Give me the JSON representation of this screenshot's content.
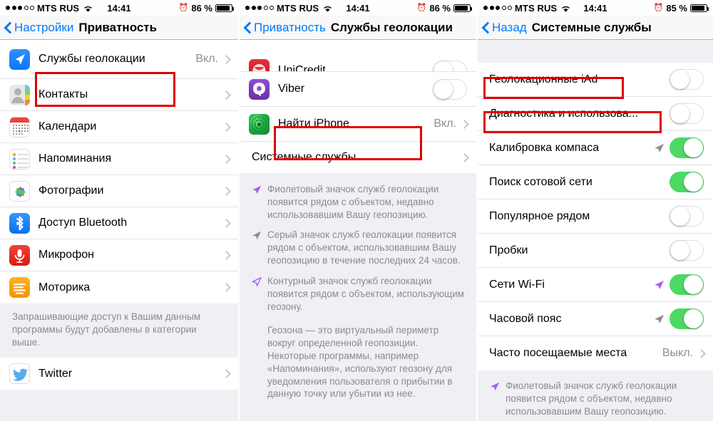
{
  "screens": [
    {
      "id": "privacy",
      "status": {
        "carrier": "MTS RUS",
        "time": "14:41",
        "battery": "86 %",
        "signal_dots": 5,
        "signal_filled": 3
      },
      "nav": {
        "back_label": "Настройки",
        "title": "Приватность"
      },
      "groups": [
        {
          "rows": [
            {
              "label": "Службы геолокации",
              "value": "Вкл.",
              "icon": "location-arrow-icon",
              "accessory": "chevron",
              "highlight": true
            },
            {
              "label": "Контакты",
              "value": "",
              "icon": "contacts-icon",
              "accessory": "chevron"
            },
            {
              "label": "Календари",
              "value": "",
              "icon": "calendar-icon",
              "accessory": "chevron"
            },
            {
              "label": "Напоминания",
              "value": "",
              "icon": "reminders-icon",
              "accessory": "chevron"
            },
            {
              "label": "Фотографии",
              "value": "",
              "icon": "photos-icon",
              "accessory": "chevron"
            },
            {
              "label": "Доступ Bluetooth",
              "value": "",
              "icon": "bluetooth-icon",
              "accessory": "chevron"
            },
            {
              "label": "Микрофон",
              "value": "",
              "icon": "microphone-icon",
              "accessory": "chevron"
            },
            {
              "label": "Моторика",
              "value": "",
              "icon": "motion-icon",
              "accessory": "chevron"
            }
          ]
        }
      ],
      "footer": "Запрашивающие доступ к Вашим данным программы будут добавлены в категории выше.",
      "group2": {
        "rows": [
          {
            "label": "Twitter",
            "value": "",
            "icon": "twitter-icon",
            "accessory": "chevron"
          }
        ]
      }
    },
    {
      "id": "location-services",
      "status": {
        "carrier": "MTS RUS",
        "time": "14:41",
        "battery": "86 %",
        "signal_dots": 5,
        "signal_filled": 3
      },
      "nav": {
        "back_label": "Приватность",
        "title": "Службы геолокации"
      },
      "groups": [
        {
          "rows": [
            {
              "label": "UniCredit",
              "icon": "unicredit-icon",
              "accessory": "toggle",
              "toggle": "off",
              "clipped": true
            },
            {
              "label": "Viber",
              "icon": "viber-icon",
              "accessory": "toggle",
              "toggle": "off"
            },
            {
              "label": "Найти iPhone",
              "value": "Вкл.",
              "icon": "find-iphone-icon",
              "accessory": "chevron"
            },
            {
              "label": "Системные службы",
              "value": "",
              "icon": "",
              "accessory": "chevron",
              "highlight": true
            }
          ]
        }
      ],
      "notes": [
        {
          "glyph": "purple",
          "text": "Фиолетовый значок служб геолокации появится рядом с объектом, недавно использовавшим Вашу геопозицию."
        },
        {
          "glyph": "gray",
          "text": "Серый значок служб геолокации появится рядом с объектом, использовавшим Вашу геопозицию в течение последних 24 часов."
        },
        {
          "glyph": "outline",
          "text": "Контурный значок служб геолокации появится рядом с объектом, использующим геозону."
        }
      ],
      "footer": "Геозона — это виртуальный периметр вокруг определенной геопозиции. Некоторые программы, например «Напоминания», используют геозону для уведомления пользователя о прибытии в данную точку или убытии из нее."
    },
    {
      "id": "system-services",
      "status": {
        "carrier": "MTS RUS",
        "time": "14:41",
        "battery": "85 %",
        "signal_dots": 5,
        "signal_filled": 3
      },
      "nav": {
        "back_label": "Назад",
        "title": "Системные службы"
      },
      "groups": [
        {
          "rows": [
            {
              "label": "Геолокационные iAd",
              "accessory": "toggle",
              "toggle": "off",
              "glyph": "none",
              "highlight": true
            },
            {
              "label": "Диагностика и использова...",
              "accessory": "toggle",
              "toggle": "off",
              "glyph": "none",
              "highlight": true
            },
            {
              "label": "Калибровка компаса",
              "accessory": "toggle",
              "toggle": "on",
              "glyph": "gray"
            },
            {
              "label": "Поиск сотовой сети",
              "accessory": "toggle",
              "toggle": "on",
              "glyph": "none"
            },
            {
              "label": "Популярное рядом",
              "accessory": "toggle",
              "toggle": "off",
              "glyph": "none"
            },
            {
              "label": "Пробки",
              "accessory": "toggle",
              "toggle": "off",
              "glyph": "none"
            },
            {
              "label": "Сети Wi-Fi",
              "accessory": "toggle",
              "toggle": "on",
              "glyph": "purple"
            },
            {
              "label": "Часовой пояс",
              "accessory": "toggle",
              "toggle": "on",
              "glyph": "gray"
            },
            {
              "label": "Часто посещаемые места",
              "value": "Выкл.",
              "accessory": "chevron",
              "glyph": "none"
            }
          ]
        }
      ],
      "notes": [
        {
          "glyph": "purple",
          "text": "Фиолетовый значок служб геолокации появится рядом с объектом, недавно использовавшим Вашу геопозицию."
        }
      ]
    }
  ],
  "colors": {
    "accent_blue": "#007aff",
    "toggle_on_green": "#4cd964",
    "highlight_red": "#e00000",
    "secondary_text": "#8e8e93",
    "group_background": "#efeff4"
  }
}
